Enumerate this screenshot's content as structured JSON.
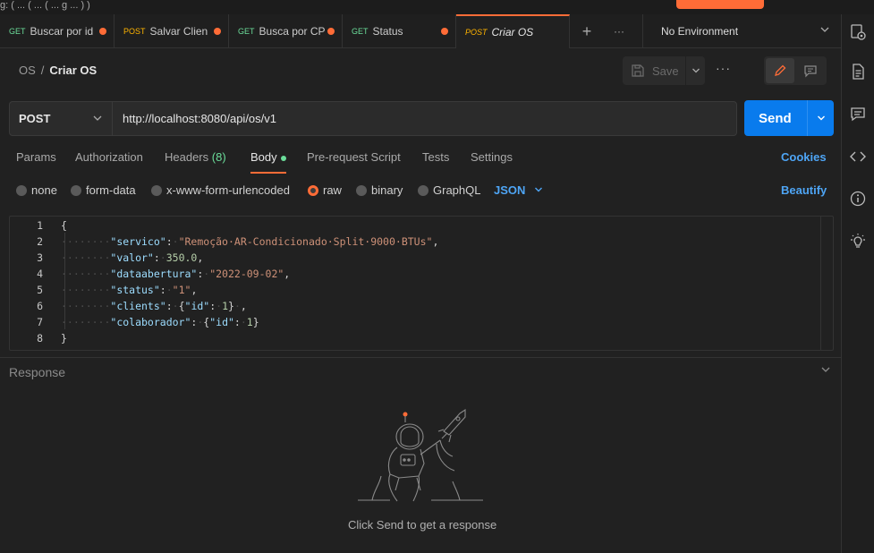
{
  "top": {
    "left_text": "g: ( ... ( ... ( ... g ... ) )"
  },
  "tabs": [
    {
      "method": "GET",
      "name": "Buscar por id"
    },
    {
      "method": "POST",
      "name": "Salvar Cliente"
    },
    {
      "method": "GET",
      "name": "Busca por CPF"
    },
    {
      "method": "GET",
      "name": "Status"
    },
    {
      "method": "POST",
      "name": "Criar OS"
    }
  ],
  "tab_actions": {
    "new": "+",
    "more": "···"
  },
  "environment": {
    "label": "No Environment"
  },
  "breadcrumb": {
    "parent": "OS",
    "separator": "/",
    "current": "Criar OS"
  },
  "toolbar": {
    "save_label": "Save",
    "more": "···"
  },
  "request": {
    "method": "POST",
    "url": "http://localhost:8080/api/os/v1",
    "send_label": "Send"
  },
  "request_tabs": {
    "params": "Params",
    "authorization": "Authorization",
    "headers": "Headers",
    "headers_count": "(8)",
    "body": "Body",
    "prescript": "Pre-request Script",
    "tests": "Tests",
    "settings": "Settings",
    "cookies": "Cookies"
  },
  "body_types": {
    "none": "none",
    "form_data": "form-data",
    "urlencoded": "x-www-form-urlencoded",
    "raw": "raw",
    "binary": "binary",
    "graphql": "GraphQL",
    "language": "JSON",
    "beautify": "Beautify"
  },
  "editor": {
    "line_numbers": [
      "1",
      "2",
      "3",
      "4",
      "5",
      "6",
      "7",
      "8"
    ]
  },
  "response": {
    "title": "Response",
    "empty_message": "Click Send to get a response"
  },
  "colors": {
    "accent": "#ff6c37",
    "primary": "#097bed",
    "link": "#4ea5f5",
    "get": "#6bdd9a",
    "post": "#ffb400"
  }
}
